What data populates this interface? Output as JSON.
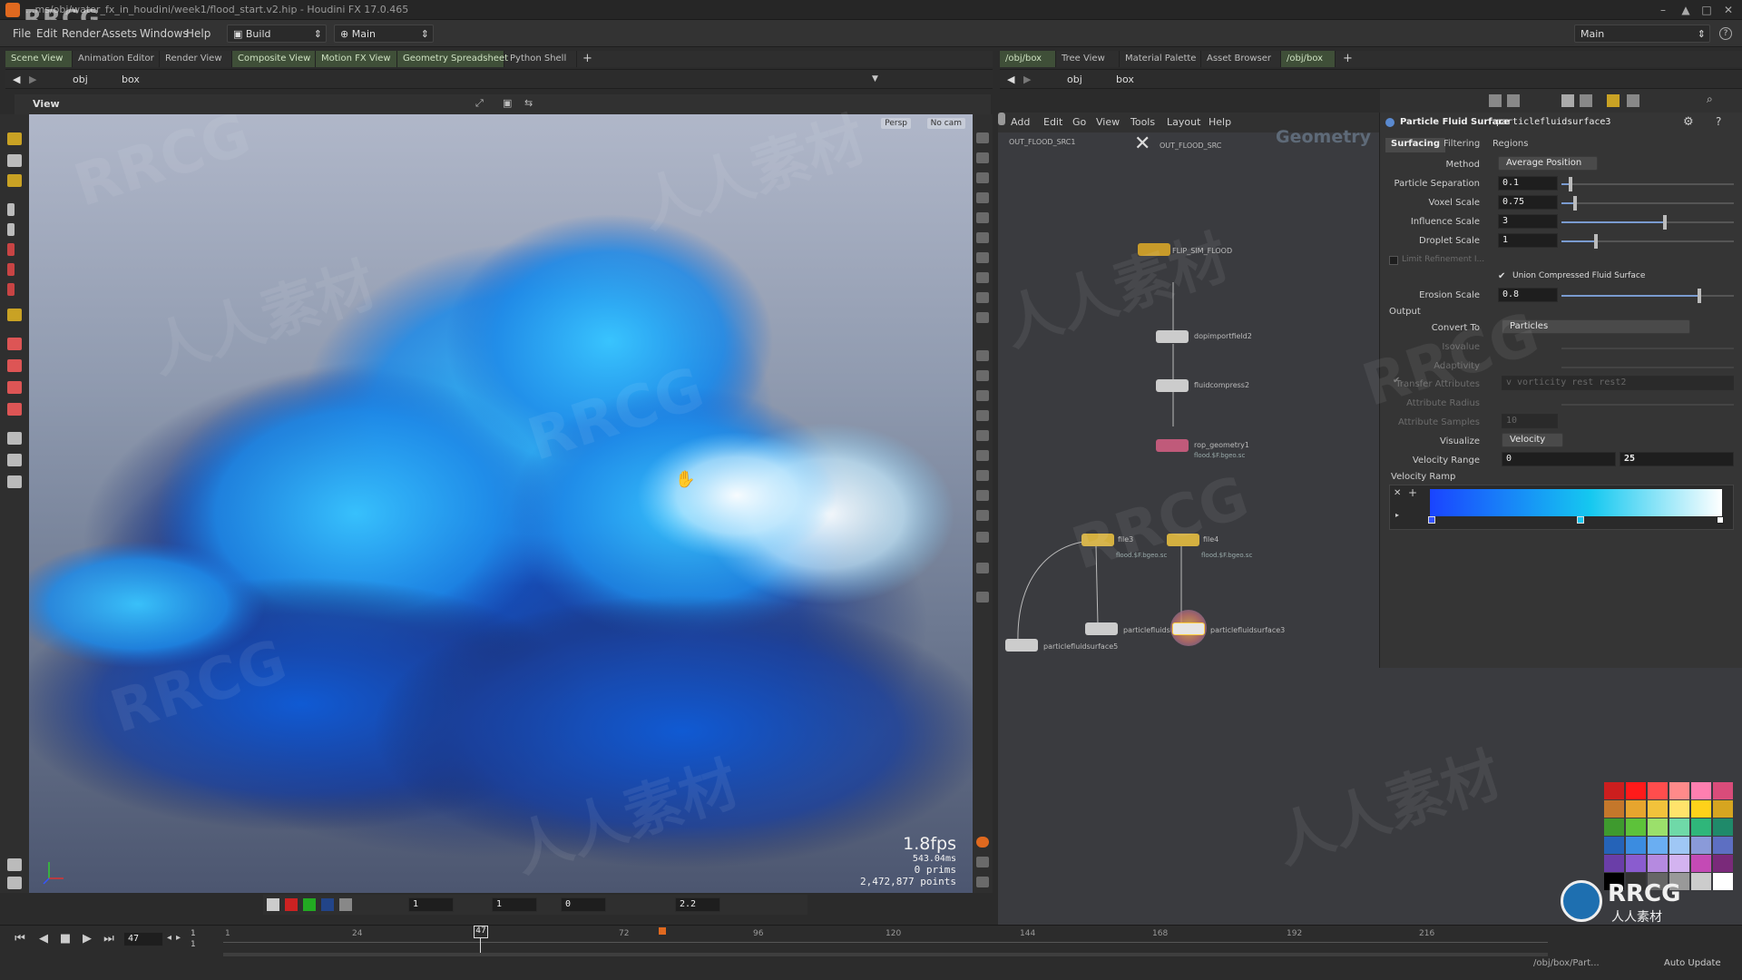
{
  "window": {
    "title": "...ms/obj/water_fx_in_houdini/week1/flood_start.v2.hip - Houdini FX 17.0.465",
    "corner_logo": "RRCG"
  },
  "menubar": {
    "items": [
      "File",
      "Edit",
      "Render",
      "Assets",
      "Windows",
      "Help"
    ],
    "build_label": "Build",
    "desktop_label": "Main",
    "right_desktop_label": "Main"
  },
  "left_tabs": [
    "Scene View",
    "Animation Editor",
    "Render View",
    "Composite View",
    "Motion FX View",
    "Geometry Spreadsheet",
    "Python Shell"
  ],
  "right_tabs": [
    "/obj/box",
    "Tree View",
    "Material Palette",
    "Asset Browser",
    "/obj/box"
  ],
  "left_path": {
    "context": "obj",
    "node": "box"
  },
  "right_path": {
    "context": "obj",
    "node": "box"
  },
  "viewport": {
    "title": "View",
    "persp_label": "Persp",
    "cam_label": "No cam",
    "fps": "1.8fps",
    "ms": "543.04ms",
    "prims": "0  prims",
    "points": "2,472,877 points"
  },
  "vp_bottom": {
    "v1": "1",
    "v2": "1",
    "v3": "0",
    "v4": "2.2"
  },
  "network": {
    "menu": [
      "Add",
      "Edit",
      "Go",
      "View",
      "Tools",
      "Layout",
      "Help"
    ],
    "context_label": "Geometry",
    "nodes": [
      {
        "name": "OUT_FLOOD_SRC1",
        "sub": ""
      },
      {
        "name": "OUT_FLOOD_SRC",
        "sub": ""
      },
      {
        "name": "FLIP_SIM_FLOOD",
        "sub": ""
      },
      {
        "name": "dopimportfield2",
        "sub": ""
      },
      {
        "name": "fluidcompress2",
        "sub": ""
      },
      {
        "name": "rop_geometry1",
        "sub": "flood.$F.bgeo.sc"
      },
      {
        "name": "file3",
        "sub": "flood.$F.bgeo.sc"
      },
      {
        "name": "file4",
        "sub": "flood.$F.bgeo.sc"
      },
      {
        "name": "particlefluidsurf...",
        "sub": ""
      },
      {
        "name": "particlefluidsurface3",
        "sub": ""
      },
      {
        "name": "particlefluidsurface5",
        "sub": ""
      }
    ]
  },
  "params": {
    "node_type": "Particle Fluid Surface",
    "node_name": "particlefluidsurface3",
    "tabs": [
      "Surfacing",
      "Filtering",
      "Regions"
    ],
    "method": {
      "label": "Method",
      "value": "Average Position"
    },
    "particle_separation": {
      "label": "Particle Separation",
      "value": "0.1",
      "slider": 0.05
    },
    "voxel_scale": {
      "label": "Voxel Scale",
      "value": "0.75",
      "slider": 0.08
    },
    "influence_scale": {
      "label": "Influence Scale",
      "value": "3",
      "slider": 0.6
    },
    "droplet_scale": {
      "label": "Droplet Scale",
      "value": "1",
      "slider": 0.2
    },
    "limit_refinement": "Limit Refinement I...",
    "union_compressed": "Union Compressed Fluid Surface",
    "erosion_scale": {
      "label": "Erosion Scale",
      "value": "0.8",
      "slider": 0.8
    },
    "output_label": "Output",
    "convert_to": {
      "label": "Convert To",
      "value": "Particles"
    },
    "isovalue": "Isovalue",
    "adaptivity": "Adaptivity",
    "transfer_attributes": {
      "label": "Transfer Attributes",
      "value": "v vorticity rest rest2"
    },
    "attribute_radius": "Attribute Radius",
    "attribute_samples": {
      "label": "Attribute Samples",
      "value": "10"
    },
    "visualize": {
      "label": "Visualize",
      "value": "Velocity"
    },
    "velocity_range": {
      "label": "Velocity Range",
      "min": "0",
      "max": "25"
    },
    "velocity_ramp_label": "Velocity Ramp"
  },
  "timeline": {
    "current_frame": "47",
    "start": "1",
    "end": "1",
    "ticks": [
      "1",
      "24",
      "47",
      "72",
      "96",
      "120",
      "144",
      "168",
      "192",
      "216"
    ],
    "path": "/obj/box/Part...",
    "auto_update": "Auto Update"
  },
  "watermarks": [
    "RRCG",
    "人人素材"
  ],
  "rrcg_logo": {
    "text": "RRCG",
    "sub": "人人素材"
  },
  "colors": {
    "accent": "#e0691f",
    "active_tab": "#3f4f38",
    "ramp_start": "#1a44ff",
    "ramp_mid": "#15c8f0",
    "ramp_end": "#ffffff"
  },
  "palette": [
    "#cc1e1e",
    "#ff1a1a",
    "#ff4d4d",
    "#ff8a8a",
    "#ff7fb0",
    "#d94c7a",
    "#c4772b",
    "#e6a52e",
    "#f2c23b",
    "#ffe36b",
    "#ffd21a",
    "#d6a520",
    "#3e9a2e",
    "#5dc23a",
    "#9be06b",
    "#6fd9a8",
    "#2fb67a",
    "#1f8a6a",
    "#2563b8",
    "#3b8ce0",
    "#6aaef2",
    "#9fc7f5",
    "#8a9ad9",
    "#5d6fc2",
    "#6a3ea8",
    "#8a5ccf",
    "#b58ae0",
    "#d3b3f0",
    "#c44ab5",
    "#7a2a7a",
    "#000000",
    "#333333",
    "#666666",
    "#999999",
    "#cccccc",
    "#ffffff"
  ]
}
